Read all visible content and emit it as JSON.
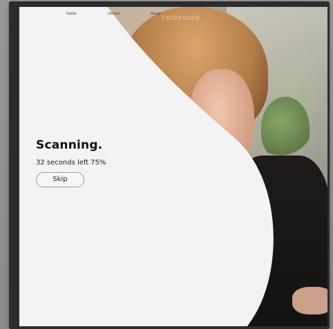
{
  "nav": {
    "items": [
      "Guide",
      "Library",
      "Setup"
    ],
    "logo_text": "TOOFOOD"
  },
  "scan": {
    "title": "Scanning.",
    "time_left": "32 seconds left",
    "percent": "75%",
    "progress": 0.75,
    "skip_label": "Skip"
  },
  "colors": {
    "overlay": "#f3f3f3",
    "title_text": "#111111",
    "bezel": "#2c2c2e"
  }
}
